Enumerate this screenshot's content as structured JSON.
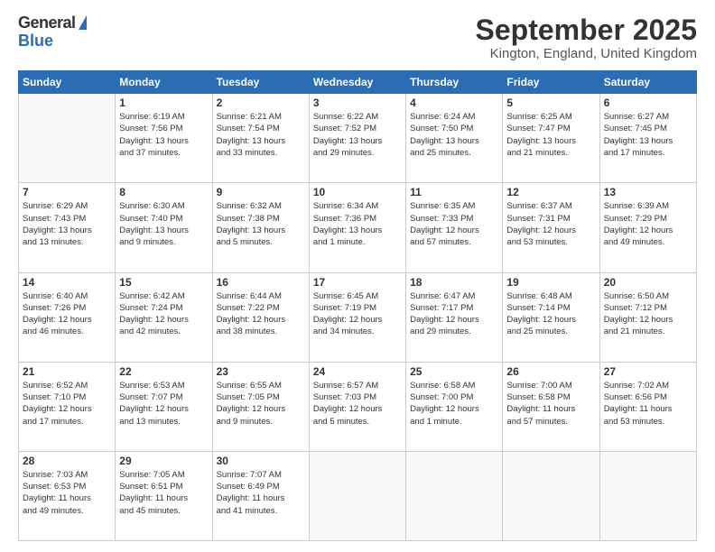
{
  "logo": {
    "general": "General",
    "blue": "Blue"
  },
  "title": "September 2025",
  "location": "Kington, England, United Kingdom",
  "days_header": [
    "Sunday",
    "Monday",
    "Tuesday",
    "Wednesday",
    "Thursday",
    "Friday",
    "Saturday"
  ],
  "weeks": [
    [
      {
        "day": "",
        "info": ""
      },
      {
        "day": "1",
        "info": "Sunrise: 6:19 AM\nSunset: 7:56 PM\nDaylight: 13 hours\nand 37 minutes."
      },
      {
        "day": "2",
        "info": "Sunrise: 6:21 AM\nSunset: 7:54 PM\nDaylight: 13 hours\nand 33 minutes."
      },
      {
        "day": "3",
        "info": "Sunrise: 6:22 AM\nSunset: 7:52 PM\nDaylight: 13 hours\nand 29 minutes."
      },
      {
        "day": "4",
        "info": "Sunrise: 6:24 AM\nSunset: 7:50 PM\nDaylight: 13 hours\nand 25 minutes."
      },
      {
        "day": "5",
        "info": "Sunrise: 6:25 AM\nSunset: 7:47 PM\nDaylight: 13 hours\nand 21 minutes."
      },
      {
        "day": "6",
        "info": "Sunrise: 6:27 AM\nSunset: 7:45 PM\nDaylight: 13 hours\nand 17 minutes."
      }
    ],
    [
      {
        "day": "7",
        "info": "Sunrise: 6:29 AM\nSunset: 7:43 PM\nDaylight: 13 hours\nand 13 minutes."
      },
      {
        "day": "8",
        "info": "Sunrise: 6:30 AM\nSunset: 7:40 PM\nDaylight: 13 hours\nand 9 minutes."
      },
      {
        "day": "9",
        "info": "Sunrise: 6:32 AM\nSunset: 7:38 PM\nDaylight: 13 hours\nand 5 minutes."
      },
      {
        "day": "10",
        "info": "Sunrise: 6:34 AM\nSunset: 7:36 PM\nDaylight: 13 hours\nand 1 minute."
      },
      {
        "day": "11",
        "info": "Sunrise: 6:35 AM\nSunset: 7:33 PM\nDaylight: 12 hours\nand 57 minutes."
      },
      {
        "day": "12",
        "info": "Sunrise: 6:37 AM\nSunset: 7:31 PM\nDaylight: 12 hours\nand 53 minutes."
      },
      {
        "day": "13",
        "info": "Sunrise: 6:39 AM\nSunset: 7:29 PM\nDaylight: 12 hours\nand 49 minutes."
      }
    ],
    [
      {
        "day": "14",
        "info": "Sunrise: 6:40 AM\nSunset: 7:26 PM\nDaylight: 12 hours\nand 46 minutes."
      },
      {
        "day": "15",
        "info": "Sunrise: 6:42 AM\nSunset: 7:24 PM\nDaylight: 12 hours\nand 42 minutes."
      },
      {
        "day": "16",
        "info": "Sunrise: 6:44 AM\nSunset: 7:22 PM\nDaylight: 12 hours\nand 38 minutes."
      },
      {
        "day": "17",
        "info": "Sunrise: 6:45 AM\nSunset: 7:19 PM\nDaylight: 12 hours\nand 34 minutes."
      },
      {
        "day": "18",
        "info": "Sunrise: 6:47 AM\nSunset: 7:17 PM\nDaylight: 12 hours\nand 29 minutes."
      },
      {
        "day": "19",
        "info": "Sunrise: 6:48 AM\nSunset: 7:14 PM\nDaylight: 12 hours\nand 25 minutes."
      },
      {
        "day": "20",
        "info": "Sunrise: 6:50 AM\nSunset: 7:12 PM\nDaylight: 12 hours\nand 21 minutes."
      }
    ],
    [
      {
        "day": "21",
        "info": "Sunrise: 6:52 AM\nSunset: 7:10 PM\nDaylight: 12 hours\nand 17 minutes."
      },
      {
        "day": "22",
        "info": "Sunrise: 6:53 AM\nSunset: 7:07 PM\nDaylight: 12 hours\nand 13 minutes."
      },
      {
        "day": "23",
        "info": "Sunrise: 6:55 AM\nSunset: 7:05 PM\nDaylight: 12 hours\nand 9 minutes."
      },
      {
        "day": "24",
        "info": "Sunrise: 6:57 AM\nSunset: 7:03 PM\nDaylight: 12 hours\nand 5 minutes."
      },
      {
        "day": "25",
        "info": "Sunrise: 6:58 AM\nSunset: 7:00 PM\nDaylight: 12 hours\nand 1 minute."
      },
      {
        "day": "26",
        "info": "Sunrise: 7:00 AM\nSunset: 6:58 PM\nDaylight: 11 hours\nand 57 minutes."
      },
      {
        "day": "27",
        "info": "Sunrise: 7:02 AM\nSunset: 6:56 PM\nDaylight: 11 hours\nand 53 minutes."
      }
    ],
    [
      {
        "day": "28",
        "info": "Sunrise: 7:03 AM\nSunset: 6:53 PM\nDaylight: 11 hours\nand 49 minutes."
      },
      {
        "day": "29",
        "info": "Sunrise: 7:05 AM\nSunset: 6:51 PM\nDaylight: 11 hours\nand 45 minutes."
      },
      {
        "day": "30",
        "info": "Sunrise: 7:07 AM\nSunset: 6:49 PM\nDaylight: 11 hours\nand 41 minutes."
      },
      {
        "day": "",
        "info": ""
      },
      {
        "day": "",
        "info": ""
      },
      {
        "day": "",
        "info": ""
      },
      {
        "day": "",
        "info": ""
      }
    ]
  ]
}
